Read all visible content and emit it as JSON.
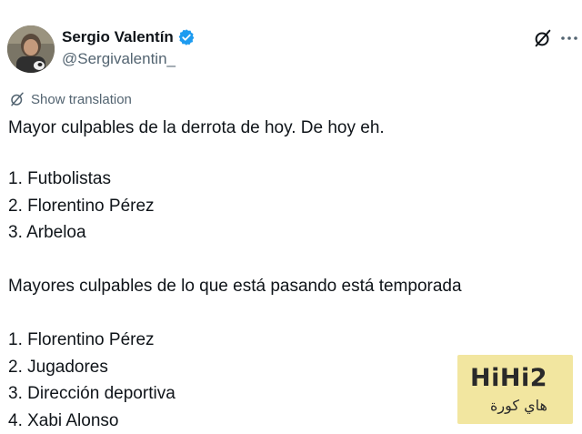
{
  "author": {
    "display_name": "Sergio Valentín",
    "handle": "@Sergivalentin_",
    "verified": true
  },
  "icons": {
    "verified": "verified-badge-icon",
    "grok": "grok-icon",
    "more": "more-options-icon",
    "translate": "translate-icon"
  },
  "translation": {
    "label": "Show translation"
  },
  "tweet": {
    "lines": [
      "Mayor culpables de la derrota de hoy. De hoy eh.",
      "1. Futbolistas",
      "2. Florentino Pérez",
      "3. Arbeloa",
      "Mayores culpables de lo que está pasando está temporada",
      "1. Florentino Pérez",
      "2. Jugadores",
      "3. Dirección deportiva",
      "4. Xabi Alonso"
    ]
  },
  "watermark": {
    "logo": "HiHi2",
    "subtitle": "هاي كورة"
  },
  "colors": {
    "text": "#0f1419",
    "muted": "#536471",
    "verified": "#1d9bf0",
    "watermark_bg": "#f2e6a0"
  }
}
